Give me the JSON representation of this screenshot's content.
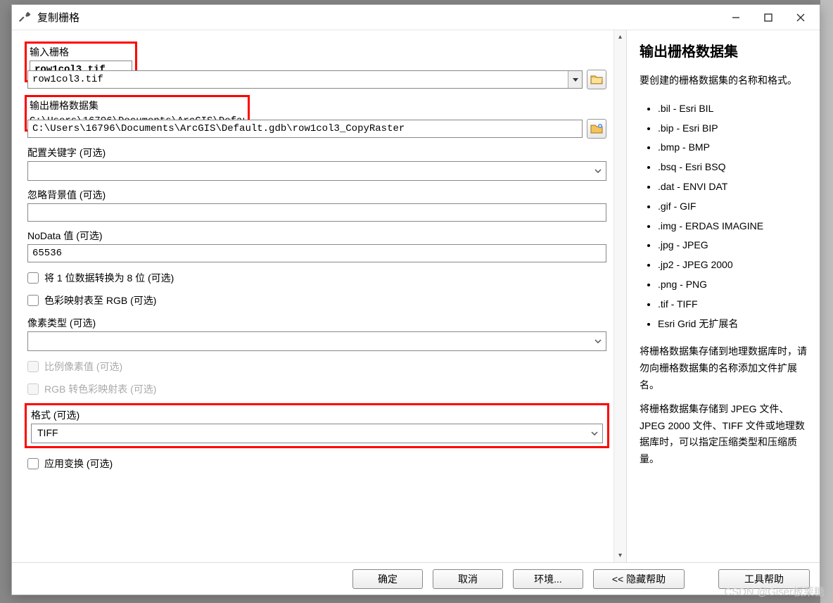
{
  "window": {
    "title": "复制栅格"
  },
  "form": {
    "input_raster": {
      "label": "输入栅格",
      "value": "row1col3.tif"
    },
    "output_raster": {
      "label": "输出栅格数据集",
      "value": "C:\\Users\\16796\\Documents\\ArcGIS\\Default.gdb\\row1col3_CopyRaster"
    },
    "config_keyword": {
      "label": "配置关键字 (可选)",
      "value": ""
    },
    "ignore_bg": {
      "label": "忽略背景值 (可选)",
      "value": ""
    },
    "nodata": {
      "label": "NoData 值 (可选)",
      "value": "65536"
    },
    "chk_1to8": "将 1 位数据转换为 8 位 (可选)",
    "chk_colormap_rgb": "色彩映射表至 RGB (可选)",
    "pixel_type": {
      "label": "像素类型 (可选)",
      "value": ""
    },
    "chk_scale_pixel": "比例像素值 (可选)",
    "chk_rgb_to_colormap": "RGB 转色彩映射表 (可选)",
    "format": {
      "label": "格式 (可选)",
      "value": "TIFF"
    },
    "chk_apply_transform": "应用变换 (可选)"
  },
  "buttons": {
    "ok": "确定",
    "cancel": "取消",
    "env": "环境...",
    "hide_help": "<< 隐藏帮助",
    "tool_help": "工具帮助"
  },
  "help": {
    "title": "输出栅格数据集",
    "intro": "要创建的栅格数据集的名称和格式。",
    "formats": [
      ".bil - Esri BIL",
      ".bip - Esri BIP",
      ".bmp - BMP",
      ".bsq - Esri BSQ",
      ".dat - ENVI DAT",
      ".gif - GIF",
      ".img - ERDAS IMAGINE",
      ".jpg - JPEG",
      ".jp2 - JPEG 2000",
      ".png - PNG",
      ".tif - TIFF",
      "Esri Grid 无扩展名"
    ],
    "note1": "将栅格数据集存储到地理数据库时，请勿向栅格数据集的名称添加文件扩展名。",
    "note2": "将栅格数据集存储到 JPEG 文件、JPEG 2000 文件、TIFF 文件或地理数据库时，可以指定压缩类型和压缩质量。"
  },
  "watermark": "CSDN @Giser板栗糖"
}
